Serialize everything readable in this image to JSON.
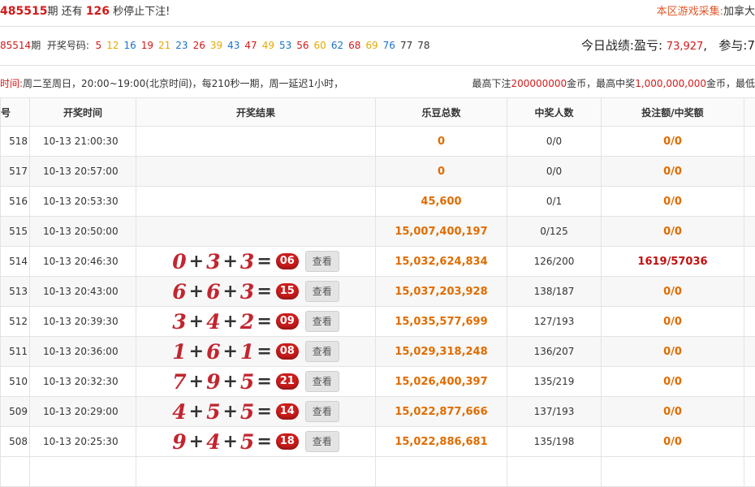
{
  "header": {
    "period_prefix": "485515",
    "period_suffix": "期",
    "remaining_prefix": "还有",
    "remaining_seconds": "126",
    "remaining_suffix": "秒停止下注!",
    "collect_label": "本区游戏采集:",
    "collect_value": "加拿大"
  },
  "draw": {
    "period": "85514",
    "period_suffix": "期",
    "label": "开奖号码:",
    "numbers": [
      {
        "n": "5",
        "color": "#d31a1a"
      },
      {
        "n": "12",
        "color": "#e6a800"
      },
      {
        "n": "16",
        "color": "#1a73c9"
      },
      {
        "n": "19",
        "color": "#d31a1a"
      },
      {
        "n": "21",
        "color": "#e6a800"
      },
      {
        "n": "23",
        "color": "#1a73c9"
      },
      {
        "n": "26",
        "color": "#d31a1a"
      },
      {
        "n": "39",
        "color": "#e6a800"
      },
      {
        "n": "43",
        "color": "#1a73c9"
      },
      {
        "n": "47",
        "color": "#d31a1a"
      },
      {
        "n": "49",
        "color": "#e6a800"
      },
      {
        "n": "53",
        "color": "#1a73c9"
      },
      {
        "n": "56",
        "color": "#d31a1a"
      },
      {
        "n": "60",
        "color": "#e6a800"
      },
      {
        "n": "62",
        "color": "#1a73c9"
      },
      {
        "n": "68",
        "color": "#d31a1a"
      },
      {
        "n": "69",
        "color": "#e6a800"
      },
      {
        "n": "76",
        "color": "#1a73c9"
      },
      {
        "n": "77",
        "color": "#333333"
      },
      {
        "n": "78",
        "color": "#333333"
      }
    ]
  },
  "stats": {
    "label": "今日战绩:盈亏:",
    "value": "73,927",
    "sep": ",",
    "join_label": "参与:7"
  },
  "notice": {
    "label": "时间:",
    "text": "周二至周日，20:00~19:00(北京时间)，每210秒一期，周一延迟1小时，",
    "max_bet_prefix": "最高下注",
    "max_bet": "200000000",
    "max_bet_mid": "金币，最高中奖",
    "max_win": "1,000,000,000",
    "max_win_suffix": "金币，最低"
  },
  "table": {
    "headers": [
      "号",
      "开奖时间",
      "开奖结果",
      "乐豆总数",
      "中奖人数",
      "投注额/中奖额",
      ""
    ],
    "look_label": "查看",
    "rows": [
      {
        "id": "518",
        "time": "10-13 21:00:30",
        "result": null,
        "total": "0",
        "winners": "0/0",
        "ratio": "0/0",
        "hot": false
      },
      {
        "id": "517",
        "time": "10-13 20:57:00",
        "result": null,
        "total": "0",
        "winners": "0/0",
        "ratio": "0/0",
        "hot": false
      },
      {
        "id": "516",
        "time": "10-13 20:53:30",
        "result": null,
        "total": "45,600",
        "winners": "0/1",
        "ratio": "0/0",
        "hot": false
      },
      {
        "id": "515",
        "time": "10-13 20:50:00",
        "result": null,
        "total": "15,007,400,197",
        "winners": "0/125",
        "ratio": "0/0",
        "hot": false
      },
      {
        "id": "514",
        "time": "10-13 20:46:30",
        "result": {
          "a": "0",
          "b": "3",
          "c": "3",
          "sum": "06"
        },
        "total": "15,032,624,834",
        "winners": "126/200",
        "ratio": "1619/57036",
        "hot": true
      },
      {
        "id": "513",
        "time": "10-13 20:43:00",
        "result": {
          "a": "6",
          "b": "6",
          "c": "3",
          "sum": "15"
        },
        "total": "15,037,203,928",
        "winners": "138/187",
        "ratio": "0/0",
        "hot": false
      },
      {
        "id": "512",
        "time": "10-13 20:39:30",
        "result": {
          "a": "3",
          "b": "4",
          "c": "2",
          "sum": "09"
        },
        "total": "15,035,577,699",
        "winners": "127/193",
        "ratio": "0/0",
        "hot": false
      },
      {
        "id": "511",
        "time": "10-13 20:36:00",
        "result": {
          "a": "1",
          "b": "6",
          "c": "1",
          "sum": "08"
        },
        "total": "15,029,318,248",
        "winners": "136/207",
        "ratio": "0/0",
        "hot": false
      },
      {
        "id": "510",
        "time": "10-13 20:32:30",
        "result": {
          "a": "7",
          "b": "9",
          "c": "5",
          "sum": "21"
        },
        "total": "15,026,400,397",
        "winners": "135/219",
        "ratio": "0/0",
        "hot": false
      },
      {
        "id": "509",
        "time": "10-13 20:29:00",
        "result": {
          "a": "4",
          "b": "5",
          "c": "5",
          "sum": "14"
        },
        "total": "15,022,877,666",
        "winners": "137/193",
        "ratio": "0/0",
        "hot": false
      },
      {
        "id": "508",
        "time": "10-13 20:25:30",
        "result": {
          "a": "9",
          "b": "4",
          "c": "5",
          "sum": "18"
        },
        "total": "15,022,886,681",
        "winners": "135/198",
        "ratio": "0/0",
        "hot": false
      }
    ]
  }
}
